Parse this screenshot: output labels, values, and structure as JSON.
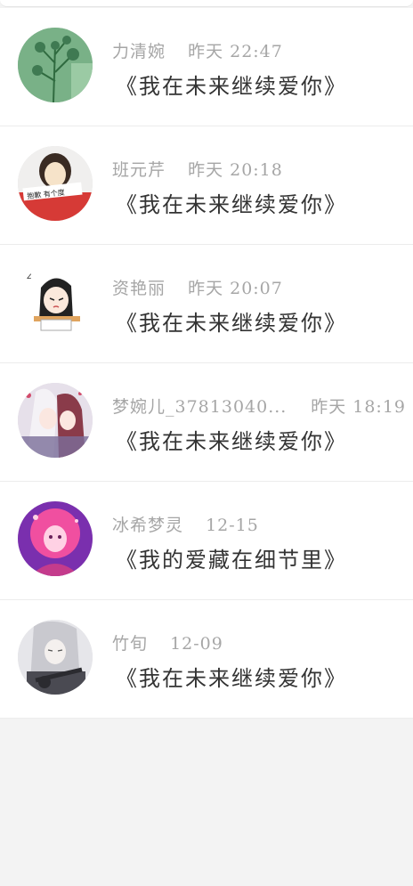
{
  "messages": [
    {
      "name": "力清婉",
      "time": "昨天 22:47",
      "text": "《我在未来继续爱你》",
      "avatar_icon": "plant-photo-avatar",
      "avatar_colors": [
        "#6aa57b",
        "#3f7a52",
        "#a9d4b0"
      ]
    },
    {
      "name": "班元芹",
      "time": "昨天 20:18",
      "text": "《我在未来继续爱你》",
      "avatar_icon": "girl-red-shirt-avatar",
      "avatar_colors": [
        "#d63a36",
        "#f6e3c9",
        "#3a2b23"
      ],
      "avatar_caption": "抱歉 有个度"
    },
    {
      "name": "资艳丽",
      "time": "昨天 20:07",
      "text": "《我在未来继续爱你》",
      "avatar_icon": "cartoon-girl-desk-avatar",
      "avatar_colors": [
        "#222222",
        "#ffffff",
        "#e0a45e"
      ],
      "avatar_caption": "z"
    },
    {
      "name": "梦婉儿_37813040...",
      "time": "昨天 18:19",
      "text": "《我在未来继续爱你》",
      "avatar_icon": "anime-couple-avatar",
      "avatar_colors": [
        "#e6e0ea",
        "#8a3b4a",
        "#7a6e9a"
      ]
    },
    {
      "name": "冰希梦灵",
      "time": "12-15",
      "text": "《我的爱藏在细节里》",
      "avatar_icon": "anime-pink-hair-avatar",
      "avatar_colors": [
        "#7a2fae",
        "#f04fa0",
        "#ffd1e4"
      ]
    },
    {
      "name": "竹旬",
      "time": "12-09",
      "text": "《我在未来继续爱你》",
      "avatar_icon": "anime-silver-hair-guitar-avatar",
      "avatar_colors": [
        "#c9c9cf",
        "#4a4a52",
        "#e6e6ea"
      ]
    }
  ]
}
